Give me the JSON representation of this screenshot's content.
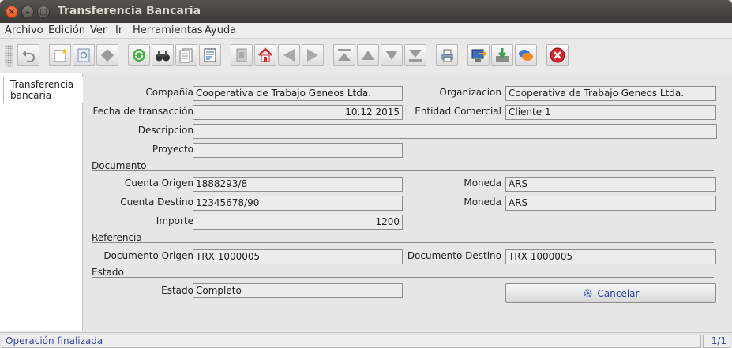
{
  "window": {
    "title": "Transferencia Bancaria",
    "close_glyph": "×",
    "minimize_glyph": "–",
    "maximize_glyph": "□"
  },
  "menu": [
    "Archivo",
    "Edición",
    "Ver",
    "Ir",
    "Herramientas",
    "Ayuda"
  ],
  "toolbar_icons": [
    "undo-icon",
    "new-record-icon",
    "copy-record-icon",
    "delete-icon",
    "refresh-icon",
    "find-icon",
    "history-icon",
    "report-icon",
    "attachment-icon",
    "home-icon",
    "previous-icon",
    "next-icon",
    "first-icon",
    "previous-record-icon",
    "next-record-icon",
    "last-icon",
    "print-icon",
    "export-icon",
    "import-icon",
    "chat-icon",
    "close-window-icon"
  ],
  "left_tab": {
    "label": "Transferencia bancaria"
  },
  "form": {
    "compania": {
      "label": "Compañía",
      "value": "Cooperativa de Trabajo Geneos Ltda."
    },
    "organizacion": {
      "label": "Organizacion",
      "value": "Cooperativa de Trabajo Geneos Ltda."
    },
    "fecha": {
      "label": "Fecha de transacción",
      "value": "10.12.2015"
    },
    "entidad": {
      "label": "Entidad Comercial",
      "value": "Cliente 1"
    },
    "descripcion": {
      "label": "Descripcion",
      "value": ""
    },
    "proyecto": {
      "label": "Proyecto",
      "value": ""
    },
    "section_documento": "Documento",
    "cuenta_origen": {
      "label": "Cuenta Origen",
      "value": "1888293/8"
    },
    "moneda_origen": {
      "label": "Moneda",
      "value": "ARS"
    },
    "cuenta_destino": {
      "label": "Cuenta Destino",
      "value": "12345678/90"
    },
    "moneda_destino": {
      "label": "Moneda",
      "value": "ARS"
    },
    "importe": {
      "label": "Importe",
      "value": "1200"
    },
    "section_referencia": "Referencia",
    "doc_origen": {
      "label": "Documento Origen",
      "value": "TRX 1000005"
    },
    "doc_destino": {
      "label": "Documento Destino",
      "value": "TRX 1000005"
    },
    "section_estado": "Estado",
    "estado": {
      "label": "Estado",
      "value": "Completo"
    },
    "cancel_button": "Cancelar"
  },
  "status": {
    "message": "Operación finalizada",
    "page": "1/1"
  },
  "colors": {
    "titlebar": "#3c3b37",
    "close_button": "#df4a16",
    "status_text": "#3a48a8",
    "cancel_text": "#2b3fa6"
  }
}
